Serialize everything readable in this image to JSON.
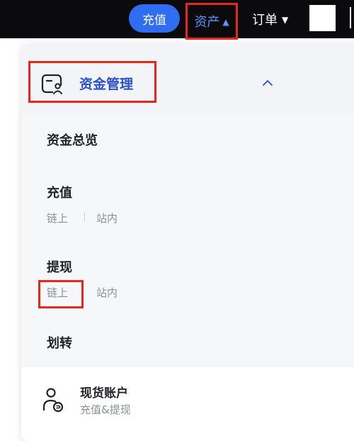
{
  "topbar": {
    "recharge_button": "充值",
    "assets_menu": "资产",
    "assets_caret": "▲",
    "orders_menu": "订单",
    "orders_caret": "▼"
  },
  "dropdown": {
    "section": {
      "title": "资金管理",
      "icon": "wallet-user-icon",
      "expanded": true
    },
    "items": [
      {
        "label": "资金总览"
      },
      {
        "label": "充值",
        "links": [
          "链上",
          "站内"
        ]
      },
      {
        "label": "提现",
        "links": [
          "链上",
          "站内"
        ]
      },
      {
        "label": "划转"
      }
    ],
    "account": {
      "title": "现货账户",
      "subtitle": "充值&提现",
      "icon": "person-coin-icon"
    }
  },
  "colors": {
    "topbar_bg": "#0b0b0e",
    "accent_blue": "#2f6ef2",
    "active_nav": "#5b93ff",
    "section_title": "#2b4fcf",
    "highlight_red": "#e8261c"
  }
}
